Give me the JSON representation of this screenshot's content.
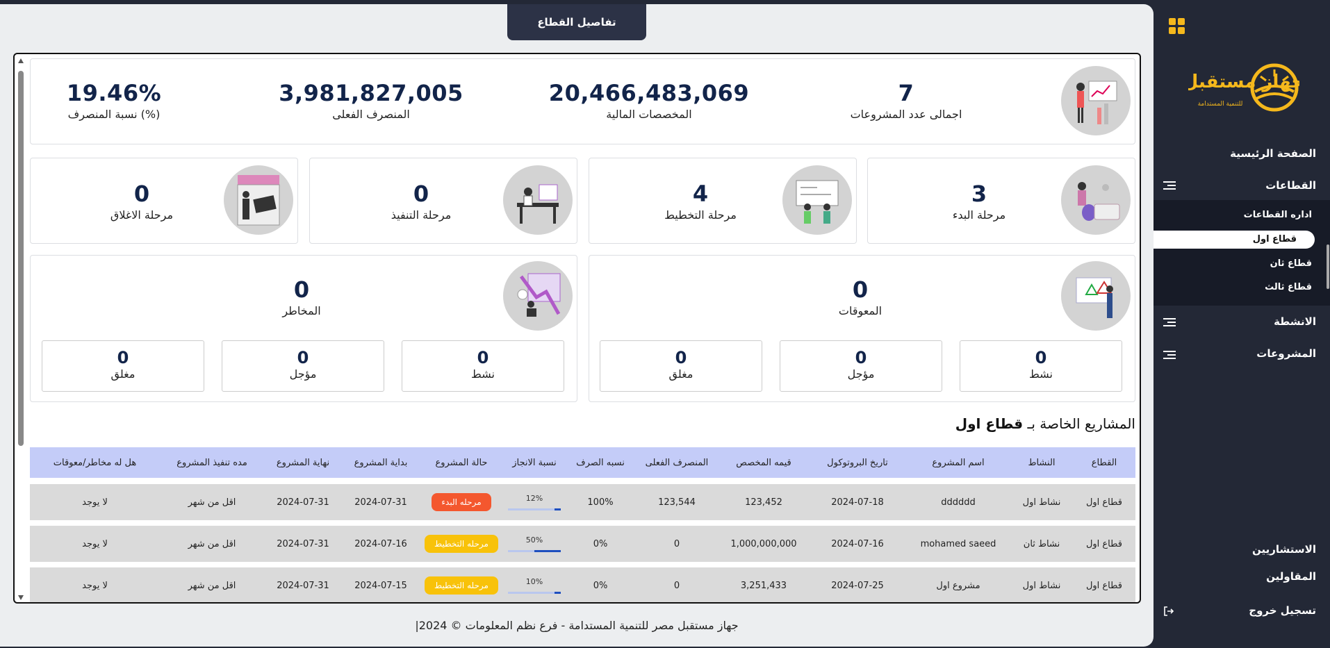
{
  "header": {
    "tab_label": "تفاصيل القطاع"
  },
  "summary": [
    {
      "value": "7",
      "label": "اجمالى عدد المشروعات"
    },
    {
      "value": "20,466,483,069",
      "label": "المخصصات المالية"
    },
    {
      "value": "3,981,827,005",
      "label": "المنصرف الفعلى"
    },
    {
      "value": "19.46%",
      "label": "نسبة المنصرف (%)"
    }
  ],
  "phases": [
    {
      "value": "3",
      "label": "مرحلة البدء"
    },
    {
      "value": "4",
      "label": "مرحلة التخطيط"
    },
    {
      "value": "0",
      "label": "مرحلة التنفيذ"
    },
    {
      "value": "0",
      "label": "مرحلة الاغلاق"
    }
  ],
  "obstacles": {
    "value": "0",
    "label": "المعوقات",
    "sub": [
      {
        "value": "0",
        "label": "نشط"
      },
      {
        "value": "0",
        "label": "مؤجل"
      },
      {
        "value": "0",
        "label": "مغلق"
      }
    ]
  },
  "risks": {
    "value": "0",
    "label": "المخاطر",
    "sub": [
      {
        "value": "0",
        "label": "نشط"
      },
      {
        "value": "0",
        "label": "مؤجل"
      },
      {
        "value": "0",
        "label": "مغلق"
      }
    ]
  },
  "projects_section": {
    "title_prefix": "المشاريع الخاصة بـ",
    "sector_name": "قطاع اول"
  },
  "table": {
    "headers": [
      "القطاع",
      "النشاط",
      "اسم المشروع",
      "تاريخ البروتوكول",
      "قيمه المخصص",
      "المنصرف الفعلى",
      "نسبه الصرف",
      "نسبة الانجاز",
      "حالة المشروع",
      "بداية المشروع",
      "نهاية المشروع",
      "مده تنفيذ المشروع",
      "هل له مخاطر/معوقات"
    ],
    "rows": [
      {
        "sector": "قطاع اول",
        "activity": "نشاط اول",
        "name": "dddddd",
        "protocol_date": "2024-07-18",
        "allocated": "123,452",
        "spent": "123,544",
        "spend_ratio": "100%",
        "progress_label": "12%",
        "progress": 0.12,
        "status": "مرحله البدء",
        "status_color": "#f4572e",
        "start": "2024-07-31",
        "end": "2024-07-31",
        "duration": "اقل من شهر",
        "risks": "لا يوجد"
      },
      {
        "sector": "قطاع اول",
        "activity": "نشاط ثان",
        "name": "mohamed saeed",
        "protocol_date": "2024-07-16",
        "allocated": "1,000,000,000",
        "spent": "0",
        "spend_ratio": "0%",
        "progress_label": "50%",
        "progress": 0.5,
        "status": "مرحله التخطيط",
        "status_color": "#f8c20a",
        "start": "2024-07-16",
        "end": "2024-07-31",
        "duration": "اقل من شهر",
        "risks": "لا يوجد"
      },
      {
        "sector": "قطاع اول",
        "activity": "نشاط اول",
        "name": "مشروع اول",
        "protocol_date": "2024-07-25",
        "allocated": "3,251,433",
        "spent": "0",
        "spend_ratio": "0%",
        "progress_label": "10%",
        "progress": 0.1,
        "status": "مرحله التخطيط",
        "status_color": "#f8c20a",
        "start": "2024-07-15",
        "end": "2024-07-31",
        "duration": "اقل من شهر",
        "risks": "لا يوجد"
      }
    ]
  },
  "footer": {
    "text": "جهاز مستقبل مصر للتنمية المستدامة - فرع نظم المعلومات © 2024|"
  },
  "sidebar": {
    "logo_text": "جهاز مستقبل مصر",
    "logo_subtext": "للتنمية المستدامة",
    "home": "الصفحة الرئيسية",
    "sectors": "القطاعات",
    "sector_items": [
      "اداره القطاعات",
      "قطاع اول",
      "قطاع ثان",
      "قطاع ثالث"
    ],
    "activities": "الانشطة",
    "projects": "المشروعات",
    "consultants": "الاستشاريين",
    "contractors": "المقاولين",
    "logout": "تسجيل خروج"
  },
  "colors": {
    "accent": "#f5b81c",
    "navy": "#12244a",
    "sidebar_bg": "#232836",
    "table_header": "#c4ccf8"
  }
}
